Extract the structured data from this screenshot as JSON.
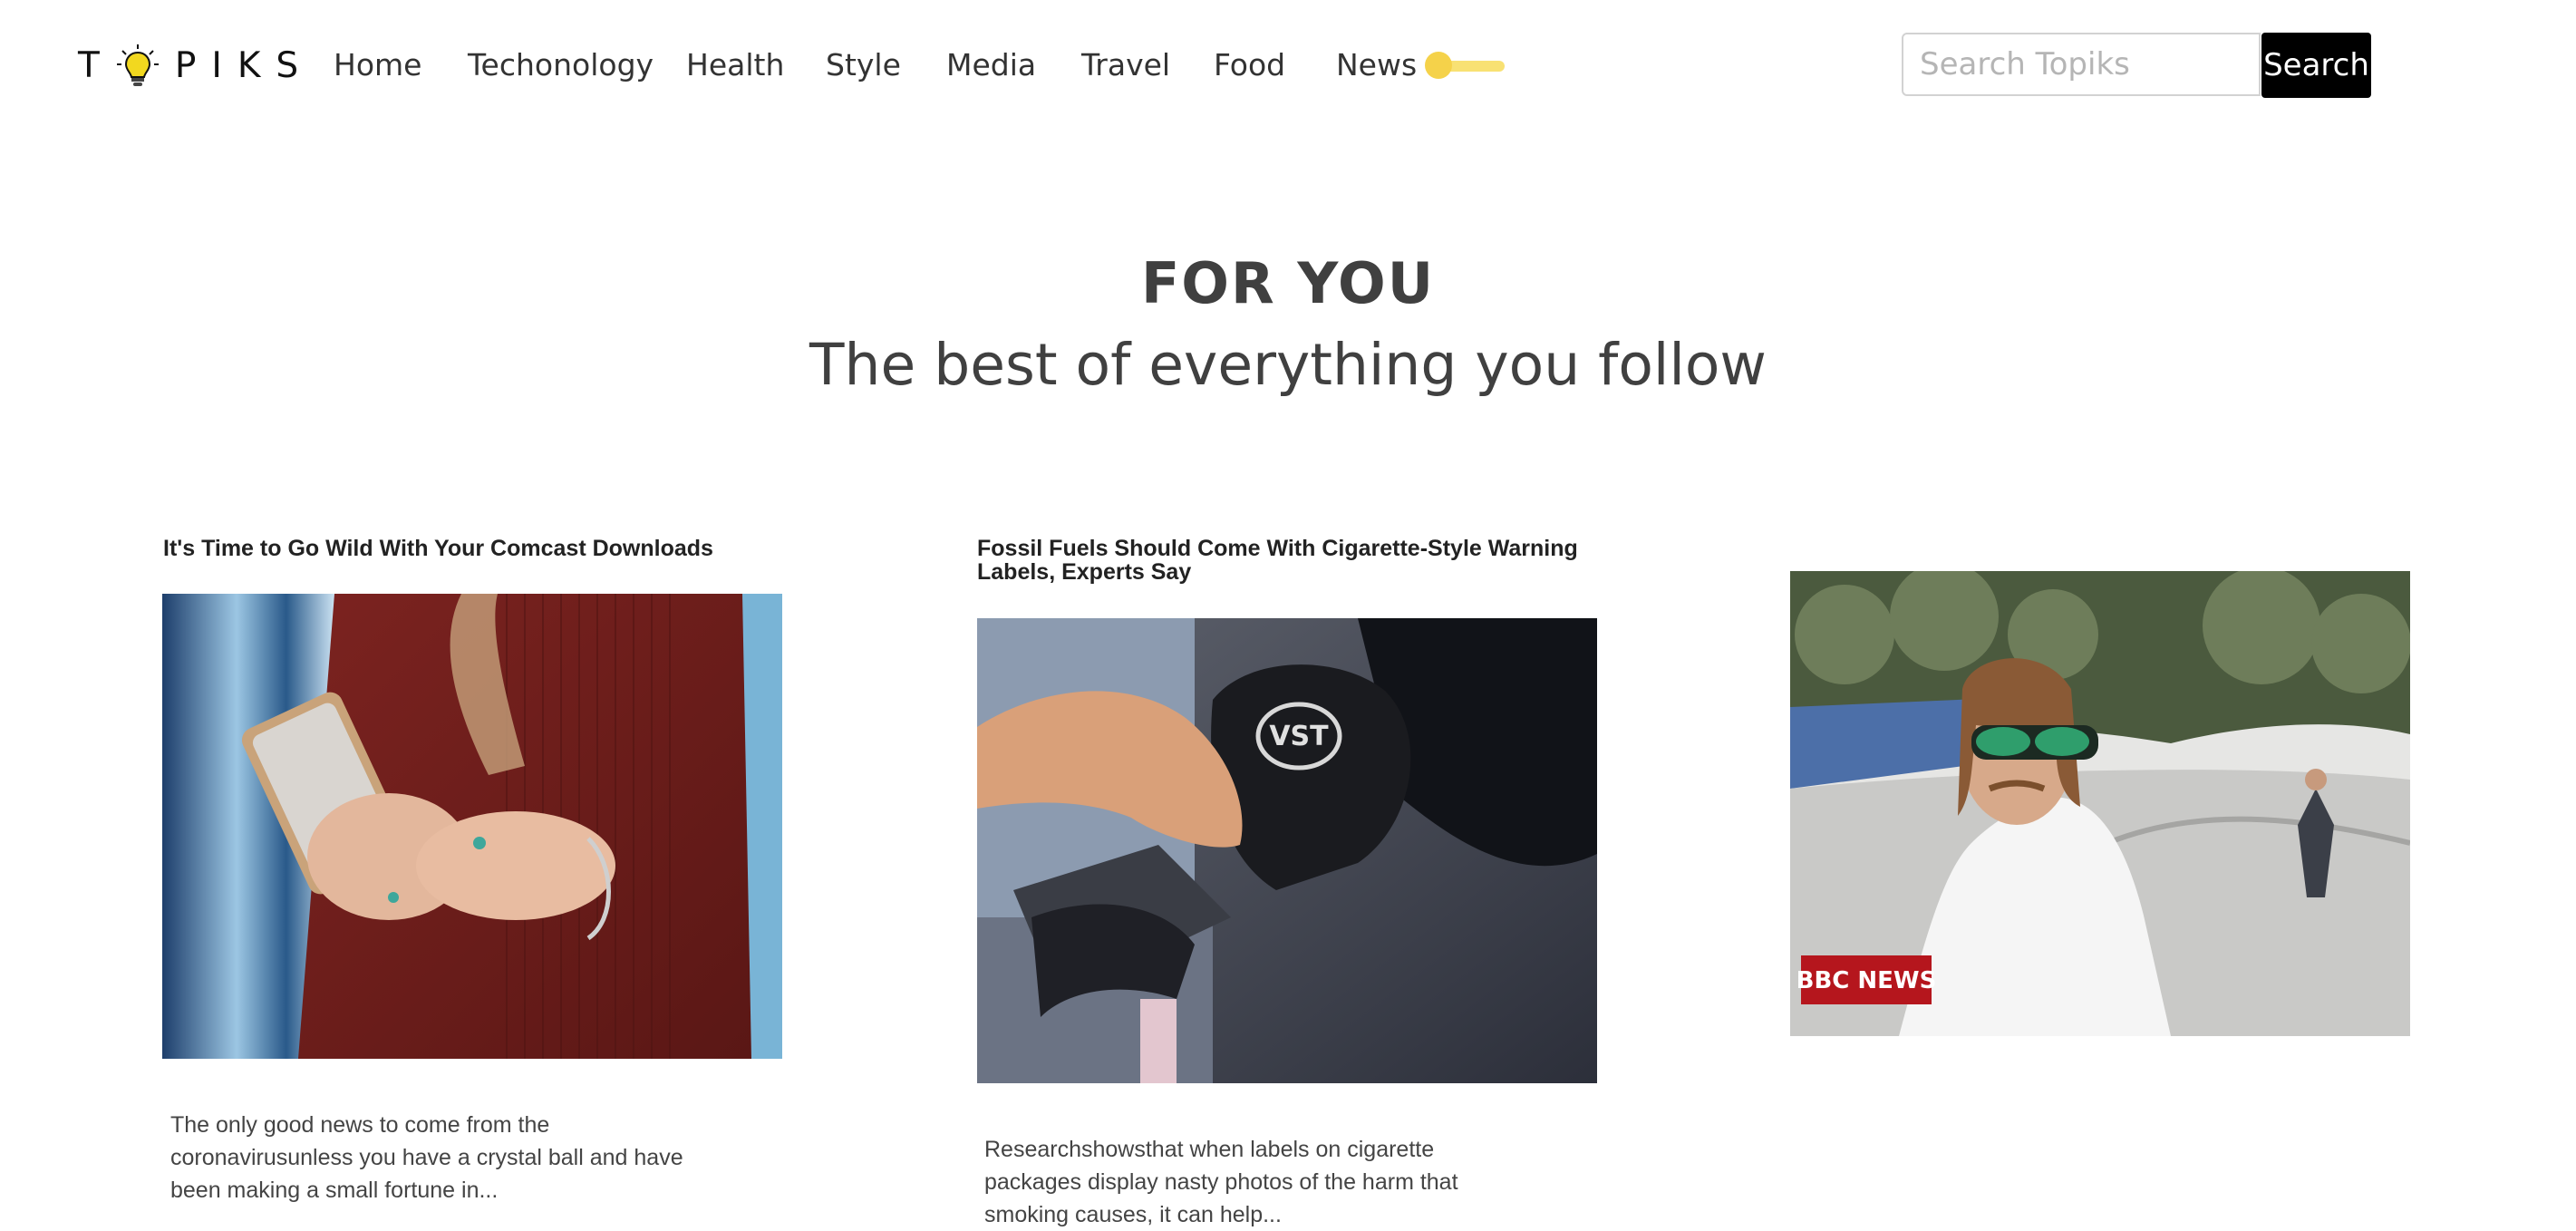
{
  "brand": {
    "logo_text": "T PIKS"
  },
  "nav": {
    "items": [
      {
        "label": "Home"
      },
      {
        "label": "Techonology"
      },
      {
        "label": "Health"
      },
      {
        "label": "Style"
      },
      {
        "label": "Media"
      },
      {
        "label": "Travel"
      },
      {
        "label": "Food"
      },
      {
        "label": "News"
      }
    ],
    "theme_toggle_icon": "toggle-switch",
    "theme_toggle_color": "#f5d24a"
  },
  "search": {
    "placeholder": "Search Topiks",
    "value": "",
    "button_label": "Search"
  },
  "hero": {
    "title": "FOR YOU",
    "subtitle": "The best of everything you follow"
  },
  "articles": [
    {
      "title": "It's Time to Go Wild With Your Comcast Downloads",
      "image_alt": "Person in a red sweater holding a smartphone",
      "description": "The only good news to come from the coronavirusunless you have a crystal ball and have been making a small fortune in..."
    },
    {
      "title": "Fossil Fuels Should Come With Cigarette-Style Warning Labels, Experts Say",
      "image_alt": "Hand holding a fuel pump nozzle in a car's fuel tank",
      "description": "Researchshowsthat when labels on cigarette packages display nasty photos of the harm that smoking causes, it can help..."
    },
    {
      "title": "",
      "image_alt": "Man with a mullet and sunglasses at a skate park",
      "image_overlay_text": "BBC NEWS",
      "description": ""
    }
  ]
}
